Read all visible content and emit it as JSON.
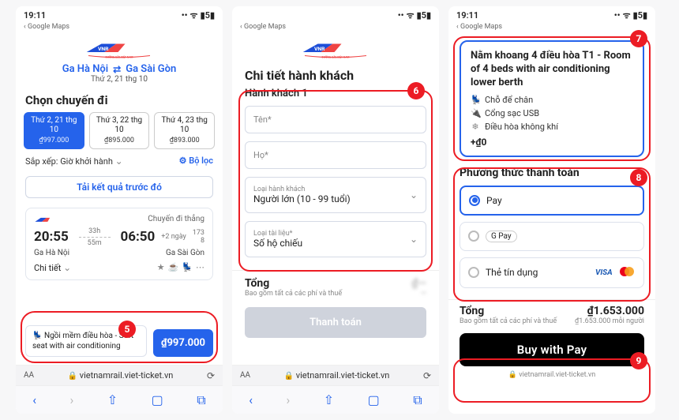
{
  "status": {
    "time": "19:11",
    "signal": "••",
    "wifi": true,
    "battery_label": "5",
    "back_app": "Google Maps"
  },
  "brand": {
    "name": "VNR",
    "tagline": "ĐƯỜNG SẮT VIỆT NAM"
  },
  "screen1": {
    "route_from": "Ga Hà Nội",
    "route_to": "Ga Sài Gòn",
    "date_sub": "Thứ 2, 21 thg 10",
    "choose_trip": "Chọn chuyến đi",
    "dates": [
      {
        "label": "Thứ 2, 21 thg 10",
        "price": "₫997.000",
        "selected": true
      },
      {
        "label": "Thứ 3, 22 thg 10",
        "price": "₫895.000",
        "selected": false
      },
      {
        "label": "Thứ 4, 23 thg 10",
        "price": "₫893.000",
        "selected": false
      }
    ],
    "sort_label": "Sắp xếp:",
    "sort_value": "Giờ khởi hành",
    "filter_label": "Bộ lọc",
    "load_prev": "Tải kết quả trước đó",
    "card": {
      "direct_label": "Chuyến đi thẳng",
      "dep_time": "20:55",
      "arr_time": "06:50",
      "arr_plus": "+2 ngày",
      "duration_h": "33h",
      "duration_m": "55m",
      "seats": "173",
      "seats_sub": "8",
      "dep_station": "Ga Hà Nội",
      "arr_station": "Ga Sài Gòn",
      "detail_label": "Chi tiết"
    },
    "seat": {
      "desc": "Ngồi mềm điều hòa - Soft seat with air conditioning",
      "price": "₫997.000"
    },
    "url": "vietnamrail.viet-ticket.vn",
    "callout_num": "5"
  },
  "screen2": {
    "title": "Chi tiết hành khách",
    "subtitle": "Hành khách 1",
    "first_name_ph": "Tên*",
    "last_name_ph": "Họ*",
    "ptype_label": "Loại hành khách",
    "ptype_value": "Người lớn (10 - 99 tuổi)",
    "doc_label": "Loại tài liệu*",
    "doc_value": "Số hộ chiếu",
    "total_label": "Tổng",
    "total_sub": "Bao gồm tất cả các phí và thuế",
    "pay_label": "Thanh toán",
    "url": "vietnamrail.viet-ticket.vn",
    "callout_num": "6"
  },
  "screen3": {
    "bed": {
      "title": "Nằm khoang 4 điều hòa T1 - Room of 4 beds with air conditioning lower berth",
      "feat1": "Chỗ để chân",
      "feat2": "Cổng sạc USB",
      "feat3": "Điều hòa không khí",
      "plus": "+₫0"
    },
    "pay_title": "Phương thức thanh toán",
    "opts": {
      "apple": "Pay",
      "google": "G Pay",
      "card": "Thẻ tín dụng"
    },
    "total_label": "Tổng",
    "total_amount": "₫1.653.000",
    "total_sub": "Bao gồm tất cả các phí và thuế",
    "per_person": "₫1.653.000 mỗi người",
    "buy_label": "Buy with Pay",
    "url": "vietnamrail.viet-ticket.vn",
    "callouts": {
      "bed": "7",
      "pay": "8",
      "buy": "9"
    }
  }
}
